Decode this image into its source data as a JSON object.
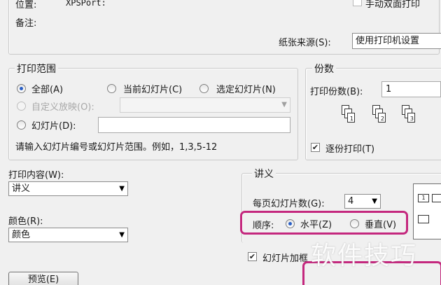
{
  "printer_info": {
    "location_label": "位置:",
    "location_value": "XPSPort:",
    "comment_label": "备注:",
    "manual_duplex_label": "手动双面打印",
    "paper_source_label": "纸张来源(S):",
    "paper_source_value": "使用打印机设置"
  },
  "print_range": {
    "legend": "打印范围",
    "all_label": "全部(A)",
    "current_slide_label": "当前幻灯片(C)",
    "selected_slides_label": "选定幻灯片(N)",
    "custom_show_label": "自定义放映(O):",
    "slides_label": "幻灯片(D):",
    "hint": "请输入幻灯片编号或幻灯片范围。例如，1,3,5-12"
  },
  "copies": {
    "legend": "份数",
    "count_label": "打印份数(B):",
    "count_value": "1",
    "collate_label": "逐份打印(T)",
    "collate_icons": [
      {
        "back": "1",
        "front": "1"
      },
      {
        "back": "2",
        "front": "2"
      },
      {
        "back": "3",
        "front": "3"
      }
    ]
  },
  "print_what": {
    "label": "打印内容(W):",
    "value": "讲义"
  },
  "color": {
    "label": "颜色(R):",
    "value": "颜色"
  },
  "handouts": {
    "legend": "讲义",
    "slides_per_page_label": "每页幻灯片数(G):",
    "slides_per_page_value": "4",
    "order_label": "顺序:",
    "order_horizontal_label": "水平(Z)",
    "order_vertical_label": "垂直(V)",
    "frame_slides_label": "幻灯片加框"
  },
  "footer": {
    "preview_button": "预览(E)"
  },
  "watermark": {
    "text": "软件技巧"
  },
  "colors": {
    "highlight": "#c4287e",
    "radio_dot": "#2a5fc4",
    "background": "#f0f0f0"
  }
}
